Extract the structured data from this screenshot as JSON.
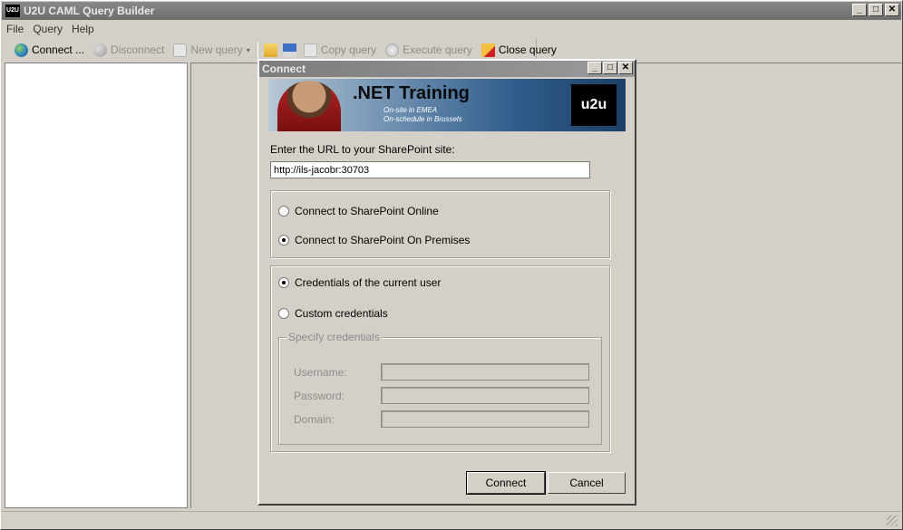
{
  "app": {
    "title": "U2U CAML Query Builder",
    "icon_text": "U2U",
    "caption_buttons": {
      "minimize": "_",
      "maximize": "□",
      "close": "✕"
    }
  },
  "menu": [
    "File",
    "Query",
    "Help"
  ],
  "toolbar": {
    "connect": "Connect ...",
    "disconnect": "Disconnect",
    "new_query": "New query",
    "copy_query": "Copy query",
    "execute_query": "Execute query",
    "close_query": "Close query",
    "dropdown_arrow": "▾"
  },
  "dialog": {
    "title": "Connect",
    "banner": {
      "title": ".NET Training",
      "line1": "On-site in EMEA",
      "line2": "On-schedule in Brussels",
      "logo": "u2u"
    },
    "url_label": "Enter the URL to your SharePoint site:",
    "url_value": "http://ils-jacobr:30703",
    "connection_options": [
      {
        "label": "Connect to SharePoint Online",
        "checked": false
      },
      {
        "label": "Connect to SharePoint On Premises",
        "checked": true
      }
    ],
    "credential_options": [
      {
        "label": "Credentials of the current user",
        "checked": true
      },
      {
        "label": "Custom credentials",
        "checked": false
      }
    ],
    "credentials_legend": "Specify credentials",
    "username_label": "Username:",
    "password_label": "Password:",
    "domain_label": "Domain:",
    "connect_button": "Connect",
    "cancel_button": "Cancel"
  }
}
